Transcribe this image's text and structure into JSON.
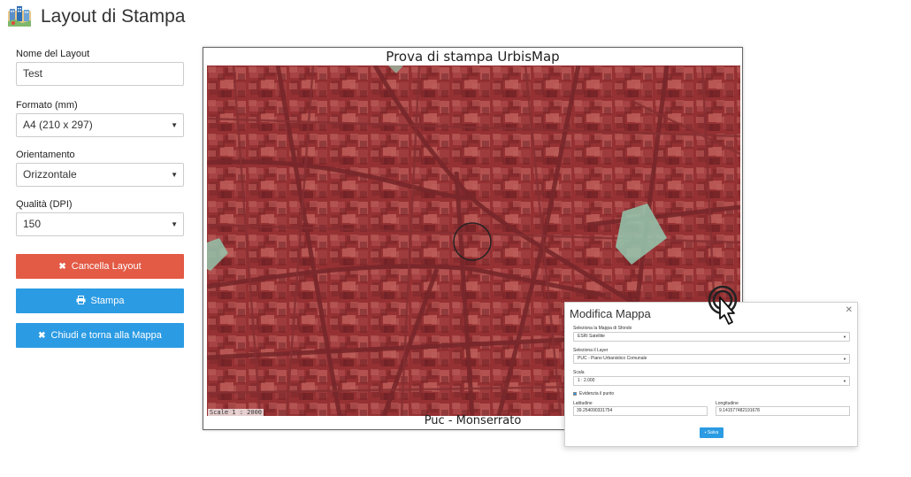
{
  "app": {
    "title": "Layout di Stampa",
    "logo_icon": "city-map-logo-icon"
  },
  "form": {
    "layout_name": {
      "label": "Nome del Layout",
      "value": "Test"
    },
    "format": {
      "label": "Formato (mm)",
      "value": "A4 (210 x 297)"
    },
    "orientation": {
      "label": "Orientamento",
      "value": "Orizzontale"
    },
    "quality": {
      "label": "Qualità (DPI)",
      "value": "150"
    }
  },
  "buttons": {
    "cancel": {
      "label": "Cancella Layout",
      "icon": "times-icon",
      "color": "#e35a45"
    },
    "print": {
      "label": "Stampa",
      "icon": "print-icon",
      "color": "#2b9be3"
    },
    "close": {
      "label": "Chiudi e torna alla Mappa",
      "icon": "times-icon",
      "color": "#2b9be3"
    }
  },
  "preview": {
    "title": "Prova di stampa UrbisMap",
    "scale": "Scale 1 : 2000",
    "footer": "Puc - Monserrato",
    "overlay_color": "#b02a2e",
    "highlight_color": "#7fe0c2"
  },
  "modal": {
    "title": "Modifica Mappa",
    "close_icon": "close-icon",
    "basemap": {
      "label": "Seleziona la Mappa di Sfondo",
      "value": "ESRI Satellite"
    },
    "layer": {
      "label": "Seleziona il Layer",
      "value": "PUC - Piano Urbanistico Comunale"
    },
    "scale": {
      "label": "Scala",
      "value": "1 : 2.000"
    },
    "highlight": {
      "label": "Evidenzia il punto",
      "checked": true
    },
    "latitude": {
      "label": "Latitudine",
      "value": "39.254090331754"
    },
    "longitude": {
      "label": "Longitudine",
      "value": "9.141577482191678"
    },
    "save": {
      "label": "Salva",
      "icon": "save-icon"
    }
  }
}
